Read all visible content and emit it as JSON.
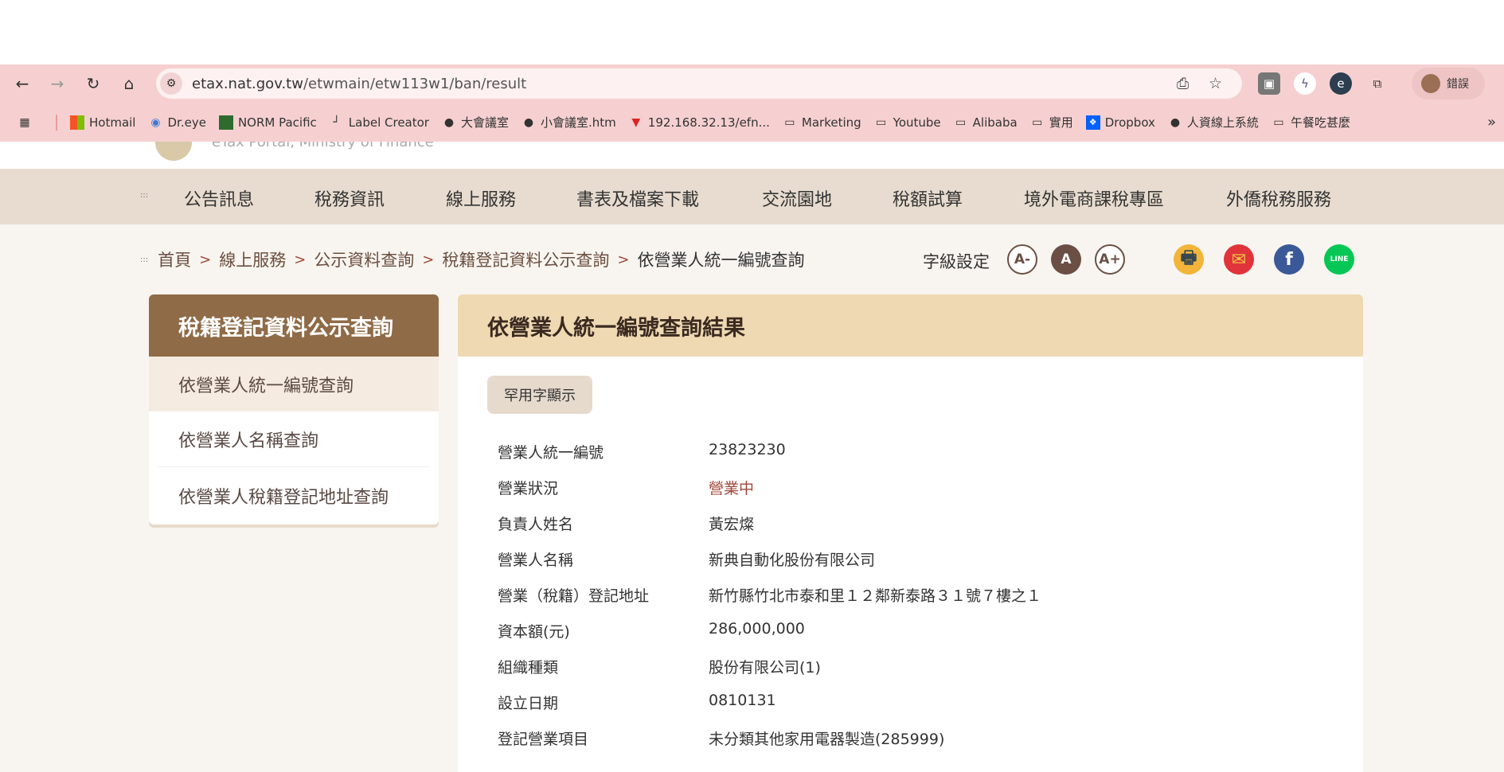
{
  "browser": {
    "url_host": "etax.nat.gov.tw",
    "url_path": "/etwmain/etw113w1/ban/result",
    "profile_label": "錯誤",
    "bookmarks": [
      "Hotmail",
      "Dr.eye",
      "NORM Pacific",
      "Label Creator",
      "大會議室",
      "小會議室.htm",
      "192.168.32.13/efn...",
      "Marketing",
      "Youtube",
      "Alibaba",
      "實用",
      "Dropbox",
      "人資線上系統",
      "午餐吃甚麼"
    ]
  },
  "site": {
    "logo_text": "eTax Portal, Ministry of Finance"
  },
  "nav": [
    "公告訊息",
    "稅務資訊",
    "線上服務",
    "書表及檔案下載",
    "交流園地",
    "稅額試算",
    "境外電商課稅專區",
    "外僑稅務服務"
  ],
  "breadcrumb": [
    "首頁",
    "線上服務",
    "公示資料查詢",
    "稅籍登記資料公示查詢",
    "依營業人統一編號查詢"
  ],
  "font_setting": {
    "label": "字級設定",
    "small": "A-",
    "normal": "A",
    "large": "A+"
  },
  "share": {
    "print": "🖶",
    "mail": "✉",
    "facebook": "f",
    "line": "LINE"
  },
  "sidebar": {
    "title": "稅籍登記資料公示查詢",
    "items": [
      "依營業人統一編號查詢",
      "依營業人名稱查詢",
      "依營業人稅籍登記地址查詢"
    ]
  },
  "main": {
    "title": "依營業人統一編號查詢結果",
    "rare_char_button": "罕用字顯示",
    "rows": [
      {
        "label": "營業人統一編號",
        "value": "23823230"
      },
      {
        "label": "營業狀況",
        "value": "營業中"
      },
      {
        "label": "負責人姓名",
        "value": "黃宏燦"
      },
      {
        "label": "營業人名稱",
        "value": "新典自動化股份有限公司"
      },
      {
        "label": "營業（稅籍）登記地址",
        "value": "新竹縣竹北市泰和里１２鄰新泰路３１號７樓之１"
      },
      {
        "label": "資本額(元)",
        "value": "286,000,000"
      },
      {
        "label": "組織種類",
        "value": "股份有限公司(1)"
      },
      {
        "label": "設立日期",
        "value": "0810131"
      },
      {
        "label": "登記營業項目",
        "value": "未分類其他家用電器製造(285999)"
      }
    ]
  }
}
